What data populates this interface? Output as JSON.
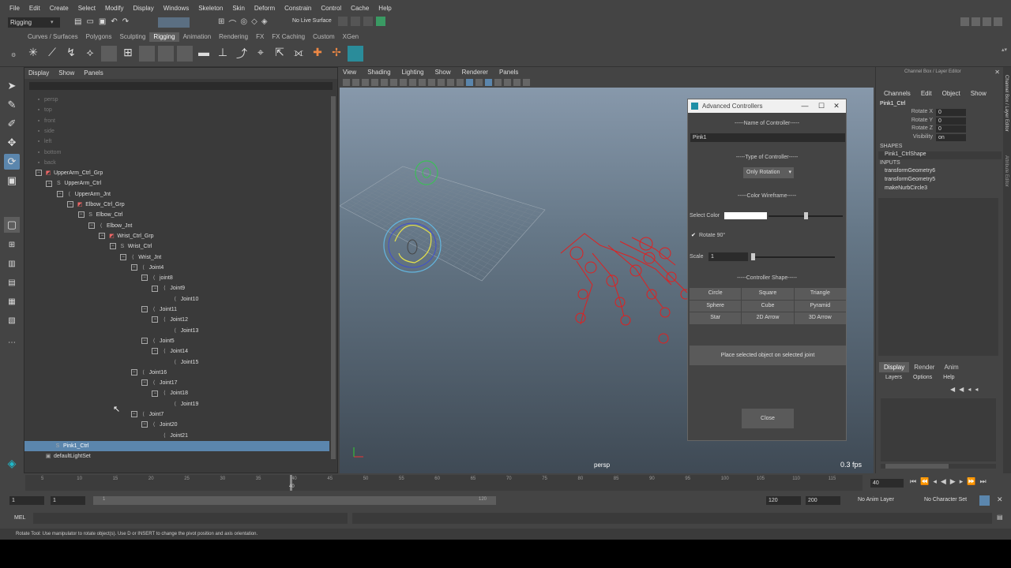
{
  "menu": [
    "File",
    "Edit",
    "Create",
    "Select",
    "Modify",
    "Display",
    "Windows",
    "Skeleton",
    "Skin",
    "Deform",
    "Constrain",
    "Control",
    "Cache",
    "Help"
  ],
  "mode": "Rigging",
  "live_surface": "No Live Surface",
  "shelf_tabs": [
    "Curves / Surfaces",
    "Polygons",
    "Sculpting",
    "Rigging",
    "Animation",
    "Rendering",
    "FX",
    "FX Caching",
    "Custom",
    "XGen"
  ],
  "outliner": {
    "menu": [
      "Display",
      "Show",
      "Panels"
    ],
    "items": [
      {
        "label": "persp",
        "indent": 0,
        "dim": true,
        "icon": "camera-icon"
      },
      {
        "label": "top",
        "indent": 0,
        "dim": true,
        "icon": "camera-icon"
      },
      {
        "label": "front",
        "indent": 0,
        "dim": true,
        "icon": "camera-icon"
      },
      {
        "label": "side",
        "indent": 0,
        "dim": true,
        "icon": "camera-icon"
      },
      {
        "label": "left",
        "indent": 0,
        "dim": true,
        "icon": "camera-icon"
      },
      {
        "label": "bottom",
        "indent": 0,
        "dim": true,
        "icon": "camera-icon"
      },
      {
        "label": "back",
        "indent": 0,
        "dim": true,
        "icon": "camera-icon"
      },
      {
        "label": "UpperArm_Ctrl_Grp",
        "indent": 0,
        "icon": "group-icon",
        "exp": true
      },
      {
        "label": "UpperArm_Ctrl",
        "indent": 1,
        "icon": "curve-icon",
        "exp": true
      },
      {
        "label": "UpperArm_Jnt",
        "indent": 2,
        "icon": "joint-icon",
        "exp": true
      },
      {
        "label": "Elbow_Ctrl_Grp",
        "indent": 3,
        "icon": "group-icon",
        "exp": true
      },
      {
        "label": "Elbow_Ctrl",
        "indent": 4,
        "icon": "curve-icon",
        "exp": true
      },
      {
        "label": "Elbow_Jnt",
        "indent": 5,
        "icon": "joint-icon",
        "exp": true
      },
      {
        "label": "Wrist_Ctrl_Grp",
        "indent": 6,
        "icon": "group-icon",
        "exp": true
      },
      {
        "label": "Wrist_Ctrl",
        "indent": 7,
        "icon": "curve-icon",
        "exp": true
      },
      {
        "label": "Wrist_Jnt",
        "indent": 8,
        "icon": "joint-icon",
        "exp": true
      },
      {
        "label": "Joint4",
        "indent": 9,
        "icon": "joint-icon",
        "exp": true
      },
      {
        "label": "joint8",
        "indent": 10,
        "icon": "joint-icon",
        "exp": true
      },
      {
        "label": "Joint9",
        "indent": 11,
        "icon": "joint-icon",
        "exp": true
      },
      {
        "label": "Joint10",
        "indent": 12,
        "icon": "joint-icon"
      },
      {
        "label": "Joint11",
        "indent": 10,
        "icon": "joint-icon",
        "exp": true
      },
      {
        "label": "Joint12",
        "indent": 11,
        "icon": "joint-icon",
        "exp": true
      },
      {
        "label": "Joint13",
        "indent": 12,
        "icon": "joint-icon"
      },
      {
        "label": "Joint5",
        "indent": 10,
        "icon": "joint-icon",
        "exp": true
      },
      {
        "label": "Joint14",
        "indent": 11,
        "icon": "joint-icon",
        "exp": true
      },
      {
        "label": "Joint15",
        "indent": 12,
        "icon": "joint-icon"
      },
      {
        "label": "Joint16",
        "indent": 9,
        "icon": "joint-icon",
        "exp": true
      },
      {
        "label": "Joint17",
        "indent": 10,
        "icon": "joint-icon",
        "exp": true
      },
      {
        "label": "Joint18",
        "indent": 11,
        "icon": "joint-icon",
        "exp": true
      },
      {
        "label": "Joint19",
        "indent": 12,
        "icon": "joint-icon"
      },
      {
        "label": "Joint7",
        "indent": 9,
        "icon": "joint-icon",
        "exp": true
      },
      {
        "label": "Joint20",
        "indent": 10,
        "icon": "joint-icon",
        "exp": true
      },
      {
        "label": "Joint21",
        "indent": 11,
        "icon": "joint-icon"
      },
      {
        "label": "Pink1_Ctrl",
        "indent": 0,
        "icon": "curve-icon",
        "selected": true
      },
      {
        "label": "defaultLightSet",
        "indent": 0,
        "icon": "set-icon"
      }
    ]
  },
  "viewport": {
    "menu": [
      "View",
      "Shading",
      "Lighting",
      "Show",
      "Renderer",
      "Panels"
    ],
    "camera": "persp",
    "fps": "0.3 fps"
  },
  "dialog": {
    "title": "Advanced Controllers",
    "name_section": "-----Name of Controller-----",
    "name_value": "Pink1",
    "type_section": "-----Type of Controller-----",
    "type_value": "Only Rotation",
    "color_section": "-----Color Wireframe-----",
    "select_color_label": "Select Color",
    "color_value": "#ffffff",
    "rotate_label": "Rotate 90°",
    "scale_label": "Scale",
    "scale_value": "1",
    "shape_section": "-----Controller Shape-----",
    "shapes": [
      "Circle",
      "Square",
      "Triangle",
      "Sphere",
      "Cube",
      "Pyramid",
      "Star",
      "2D Arrow",
      "3D Arrow"
    ],
    "place_button": "Place selected object on selected joint",
    "close_button": "Close"
  },
  "channel_box": {
    "title": "Channel Box / Layer Editor",
    "menu": [
      "Channels",
      "Edit",
      "Object",
      "Show"
    ],
    "object": "Pink1_Ctrl",
    "attrs": [
      {
        "name": "Rotate X",
        "value": "0"
      },
      {
        "name": "Rotate Y",
        "value": "0"
      },
      {
        "name": "Rotate Z",
        "value": "0"
      },
      {
        "name": "Visibility",
        "value": "on"
      }
    ],
    "shapes_header": "SHAPES",
    "shape_name": "Pink1_CtrlShape",
    "inputs_header": "INPUTS",
    "inputs": [
      "transformGeometry6",
      "transformGeometry5",
      "makeNurbCircle3"
    ],
    "layer_tabs": [
      "Display",
      "Render",
      "Anim"
    ],
    "layer_menu": [
      "Layers",
      "Options",
      "Help"
    ],
    "side_tabs": [
      "Channel Box / Layer Editor",
      "Attribute Editor"
    ]
  },
  "timeline": {
    "ticks": [
      "5",
      "10",
      "15",
      "20",
      "25",
      "30",
      "35",
      "40",
      "45",
      "50",
      "55",
      "60",
      "65",
      "70",
      "75",
      "80",
      "85",
      "90",
      "95",
      "100",
      "105",
      "110",
      "115"
    ],
    "current_frame": "40",
    "current_frame_field": "40"
  },
  "range": {
    "start": "1",
    "playback_start": "1",
    "slider_start": "1",
    "slider_end": "120",
    "playback_end": "120",
    "end": "200",
    "anim_layer": "No Anim Layer",
    "char_set": "No Character Set"
  },
  "cmdline": {
    "label": "MEL"
  },
  "help_line": "Rotate Tool: Use manipulator to rotate object(s). Use D or INSERT to change the pivot position and axis orientation."
}
